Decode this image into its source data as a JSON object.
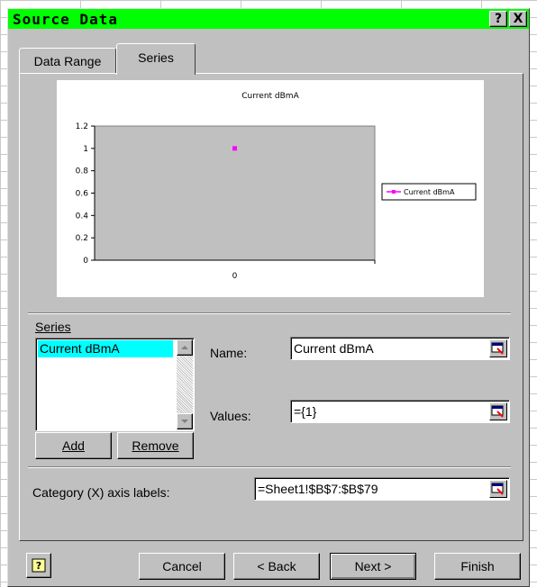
{
  "dialog": {
    "title": "Source Data",
    "help_glyph": "?",
    "close_glyph": "X"
  },
  "tabs": [
    {
      "label": "Data Range",
      "active": false
    },
    {
      "label": "Series",
      "active": true
    }
  ],
  "chart_data": {
    "type": "line",
    "title": "Current dBmA",
    "categories": [
      "0"
    ],
    "series": [
      {
        "name": "Current dBmA",
        "values": [
          1
        ],
        "color": "#ff00ff"
      }
    ],
    "ylim": [
      0,
      1.2
    ],
    "yticks": [
      "0",
      "0.2",
      "0.4",
      "0.6",
      "0.8",
      "1",
      "1.2"
    ],
    "grid": false,
    "legend": "right",
    "plot_bg": "#c0c0c0"
  },
  "series_section": {
    "label": "Series",
    "items": [
      "Current dBmA"
    ],
    "add_label": "Add",
    "remove_label": "Remove"
  },
  "name_field": {
    "label": "Name:",
    "value": "Current dBmA"
  },
  "values_field": {
    "label": "Values:",
    "value": "={1}"
  },
  "category_field": {
    "label": "Category (X) axis labels:",
    "value": "=Sheet1!$B$7:$B$79"
  },
  "footer": {
    "cancel": "Cancel",
    "back": "< Back",
    "next": "Next >",
    "finish": "Finish"
  },
  "colors": {
    "titlebar": "#00ff00",
    "selection": "#00ffff",
    "dialog_bg": "#c0c0c0"
  }
}
